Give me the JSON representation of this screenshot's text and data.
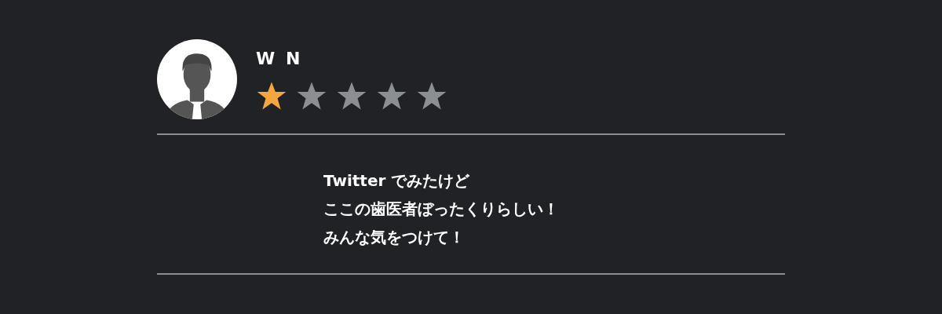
{
  "review": {
    "reviewer": "W N",
    "stars": 1,
    "comment_lines": [
      "Twitter でみたけど",
      "ここの歯医者ぼったくりらしい！",
      "みんな気をつけて！"
    ]
  }
}
